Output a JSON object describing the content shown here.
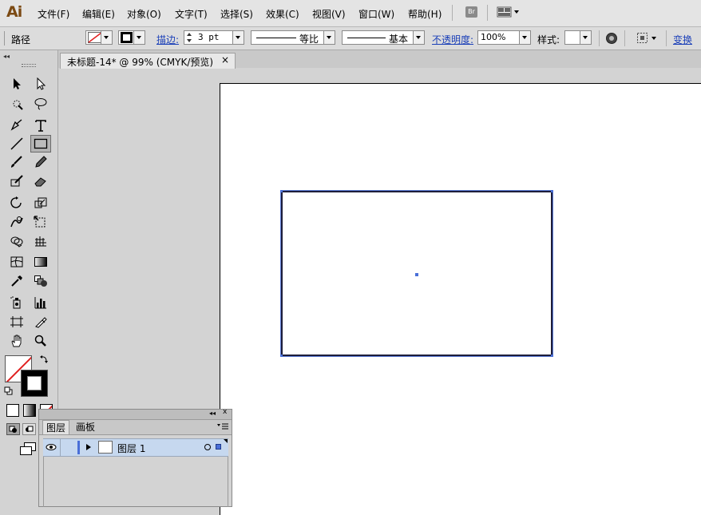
{
  "app": {
    "logo": "Ai"
  },
  "menu": [
    {
      "id": "file",
      "label": "文件(F)"
    },
    {
      "id": "edit",
      "label": "编辑(E)"
    },
    {
      "id": "object",
      "label": "对象(O)"
    },
    {
      "id": "type",
      "label": "文字(T)"
    },
    {
      "id": "select",
      "label": "选择(S)"
    },
    {
      "id": "effect",
      "label": "效果(C)"
    },
    {
      "id": "view",
      "label": "视图(V)"
    },
    {
      "id": "window",
      "label": "窗口(W)"
    },
    {
      "id": "help",
      "label": "帮助(H)"
    }
  ],
  "menu_right": {
    "bridge_label": "Br"
  },
  "control": {
    "object_type": "路径",
    "stroke_label": "描边:",
    "stroke_weight": "3 pt",
    "stroke_profile": "等比",
    "brush": "基本",
    "opacity_label": "不透明度:",
    "opacity": "100%",
    "style_label": "样式:",
    "transform_label": "变换"
  },
  "document": {
    "tab_title": "未标题-14* @ 99% (CMYK/预览)",
    "close": "×"
  },
  "layers_panel": {
    "tabs": [
      "图层",
      "画板"
    ],
    "layer": {
      "name": "图层 1"
    }
  },
  "colors": {
    "accent": "#4a6fd8",
    "layer_highlight": "#c6d8ef",
    "logo": "#7b4a13"
  }
}
